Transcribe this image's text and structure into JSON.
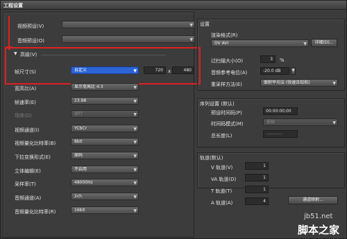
{
  "window": {
    "title": "工程设置"
  },
  "left": {
    "video_preset": {
      "label": "视频预设(V)",
      "value": ""
    },
    "audio_preset": {
      "label": "音频预设(O)",
      "value": ""
    },
    "advanced": {
      "toggle": "▼",
      "label": "高级(V)"
    },
    "frame_size": {
      "label": "帧尺寸(S)",
      "value": "自定义",
      "width": "720",
      "times": "x",
      "height": "480"
    },
    "aspect": {
      "label": "宽高比(A)",
      "value": "显示宽高比 4:3"
    },
    "frame_rate": {
      "label": "帧速率(E)",
      "value": "23.98"
    },
    "field_order": {
      "label": "场序(D)",
      "value": "逐行"
    },
    "video_channel": {
      "label": "视频通道(I)",
      "value": "YCbCr"
    },
    "video_quant": {
      "label": "视频量化比特率(B)",
      "value": "8bit"
    },
    "pulldown": {
      "label": "下拉变换形式(E)",
      "value": "原码"
    },
    "stereo": {
      "label": "立体编辑(E)",
      "value": "不启用"
    },
    "sample_rate": {
      "label": "采样率(T)",
      "value": "48000Hz"
    },
    "audio_channel": {
      "label": "音频通道(A)",
      "value": "2ch"
    },
    "audio_quant": {
      "label": "音频量化比特率(R)",
      "value": "16bit"
    }
  },
  "right": {
    "settings_title": "设置",
    "render_format": {
      "label": "渲染格式(R)",
      "value": "DV AVI",
      "detail_button": "详细(D)..."
    },
    "overscan": {
      "label": "过扫描大小(O)",
      "value": "3",
      "unit": "%"
    },
    "audio_ref": {
      "label": "音频参考电位(A)",
      "value": "-20.0 dB"
    },
    "resample": {
      "label": "重采样方法(E)",
      "value": "面积平均法 (快速且较和)"
    },
    "sequence_title": "序列设置 (默认)",
    "preset_timecode": {
      "label": "预设时间码(P)",
      "value": "00:00:00;00"
    },
    "timecode_mode": {
      "label": "时间码模式(M)",
      "value": "丢帧"
    },
    "total_length": {
      "label": "总长度(L)",
      "value": "--:--:--:--"
    },
    "tracks_title": "轨道(默认)",
    "v_track": {
      "label": "V 轨道(V)",
      "value": "1"
    },
    "va_track": {
      "label": "VA 轨道(D)",
      "value": "1"
    },
    "t_track": {
      "label": "T 轨道(T)",
      "value": "1"
    },
    "a_track": {
      "label": "A 轨道(A)",
      "value": "4"
    },
    "channel_button": "通道映射..."
  },
  "watermark": {
    "site": "jb51.net",
    "brand": "脚本之家"
  },
  "colors": {
    "highlight": "#e02020",
    "selected": "#2b64d6"
  }
}
